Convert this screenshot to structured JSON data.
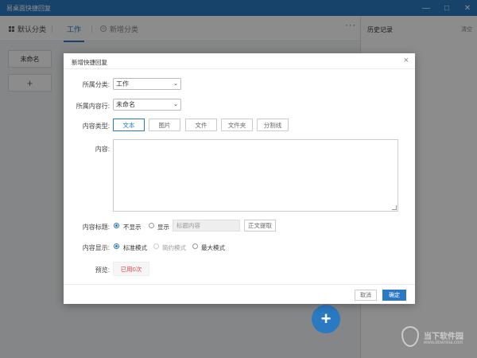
{
  "window": {
    "title": "易桌面快捷回复",
    "minimize": "—",
    "maximize": "□",
    "close": "✕"
  },
  "tabs": [
    {
      "label": "默认分类"
    },
    {
      "label": "工作"
    },
    {
      "label": "新增分类"
    }
  ],
  "more_label": "···",
  "history": {
    "title": "历史记录",
    "clear": "清空"
  },
  "sidebar": {
    "card_label": "未命名",
    "add_label": "+"
  },
  "fab_label": "+",
  "dialog": {
    "title": "新增快捷回复",
    "close": "×",
    "category_label": "所属分类:",
    "category_value": "工作",
    "row_label": "所属内容行:",
    "row_value": "未命名",
    "type_label": "内容类型:",
    "types": [
      "文本",
      "图片",
      "文件",
      "文件夹",
      "分割线"
    ],
    "content_label": "内容:",
    "content_title_label": "内容标题:",
    "title_options": [
      "不显示",
      "显示"
    ],
    "title_placeholder": "标题内容",
    "extract_label": "正文提取",
    "display_label": "内容显示:",
    "display_options": [
      "标准模式",
      "简约模式",
      "最大模式"
    ],
    "preview_label": "预览:",
    "preview_text": "已用0次",
    "cancel": "取消",
    "ok": "确定"
  },
  "watermark": {
    "name": "当下软件园",
    "url": "www.downxia.com"
  },
  "colors": {
    "accent": "#2b79c2",
    "preview_red": "#e04444"
  }
}
